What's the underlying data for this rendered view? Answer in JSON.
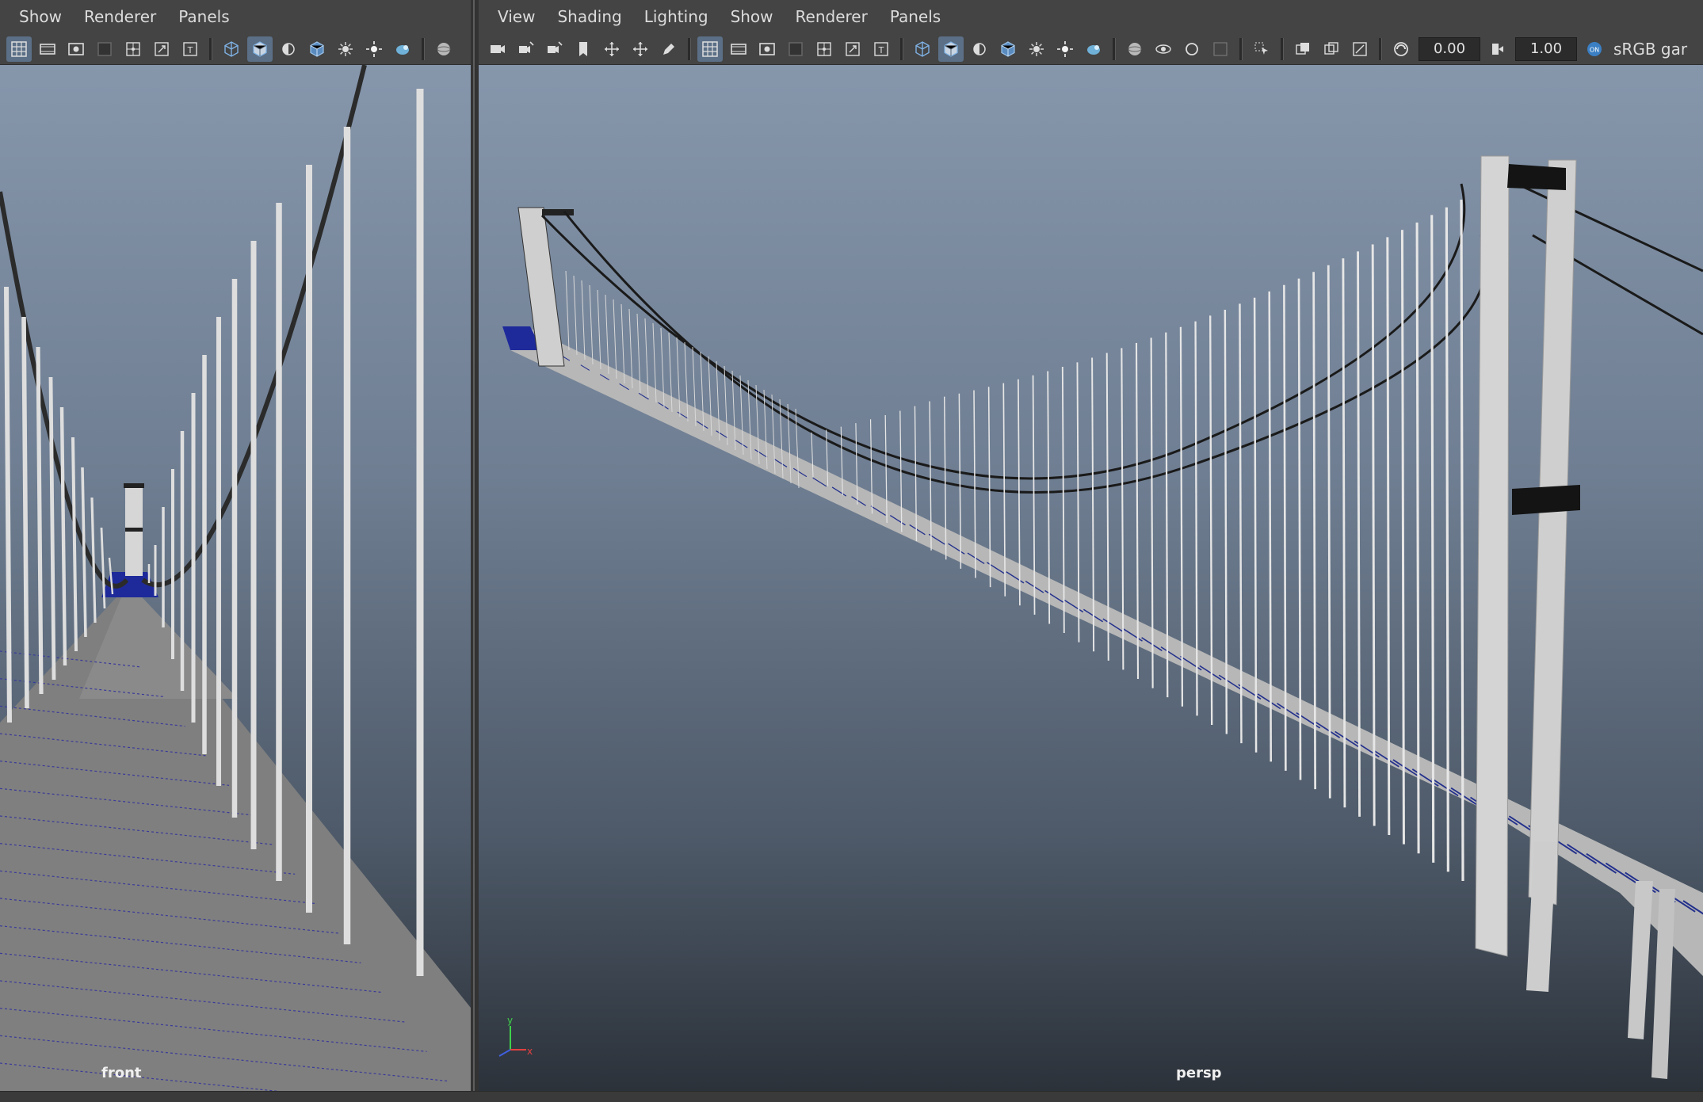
{
  "front_panel": {
    "menu": [
      "Show",
      "Renderer",
      "Panels"
    ],
    "camera_label": "front"
  },
  "persp_panel": {
    "menu": [
      "View",
      "Shading",
      "Lighting",
      "Show",
      "Renderer",
      "Panels"
    ],
    "camera_label": "persp",
    "exposure_value": "0.00",
    "gamma_value": "1.00",
    "color_management_toggle": "ON",
    "color_space_label": "sRGB gar",
    "axis_labels": {
      "y": "y",
      "x": "x"
    }
  },
  "colors": {
    "menu_bg": "#444444",
    "active_button": "#5b6f86",
    "viewport_top": "#8696ab",
    "viewport_bottom": "#2c323a",
    "bridge_structure": "#c9c9c9",
    "selection_blue": "#1e2a9a"
  },
  "icons": [
    "grid-icon",
    "film-gate-icon",
    "resolution-gate-icon",
    "gate-mask-icon",
    "field-chart-icon",
    "safe-action-icon",
    "safe-title-icon",
    "wireframe-icon",
    "smooth-shade-icon",
    "default-lighting-icon",
    "textured-icon",
    "shadows-icon",
    "lights-icon",
    "xray-icon",
    "isolate-icon",
    "camera-icon",
    "exposure-icon",
    "gamma-icon"
  ]
}
